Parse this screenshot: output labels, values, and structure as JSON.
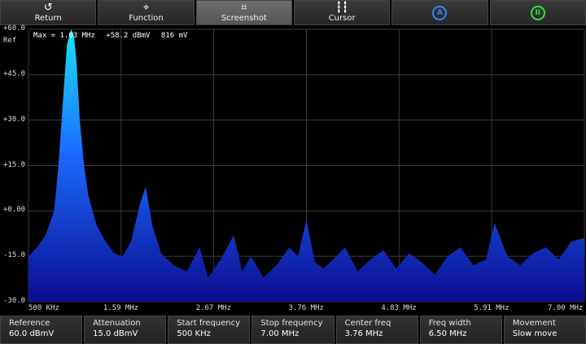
{
  "toolbar": {
    "return_label": "Return",
    "function_label": "Function",
    "screenshot_label": "Screenshot",
    "cursor_label": "Cursor",
    "auto_label": "A",
    "pause_label": "II"
  },
  "marker": {
    "max": "Max = 1.03 MHz",
    "level": "+58.2 dBmV",
    "voltage": "816 mV"
  },
  "axes": {
    "y_top_extra": "Ref",
    "y_ticks": [
      "+60.0",
      "+45.0",
      "+30.0",
      "+15.0",
      "+0.00",
      "-15.0",
      "-30.0"
    ],
    "x_ticks": [
      "500 KHz",
      "1.59 MHz",
      "2.67 MHz",
      "3.76 MHz",
      "4.83 MHz",
      "5.91 MHz",
      "7.00 MHz"
    ]
  },
  "colors": {
    "trace_top": "#19e4ff",
    "trace_bottom": "#1010a0",
    "grid": "#3c3c3c"
  },
  "params": [
    {
      "label": "Reference",
      "value": "60.0 dBmV"
    },
    {
      "label": "Attenuation",
      "value": "15.0 dBmV"
    },
    {
      "label": "Start frequency",
      "value": "500 KHz"
    },
    {
      "label": "Stop frequency",
      "value": "7.00 MHz"
    },
    {
      "label": "Center freq",
      "value": "3.76 MHz"
    },
    {
      "label": "Freq width",
      "value": "6.50 MHz"
    },
    {
      "label": "Movement",
      "value": "Slow move"
    }
  ],
  "chart_data": {
    "type": "area",
    "xlim": [
      0.5,
      7.0
    ],
    "ylim": [
      -30,
      60
    ],
    "x": [
      0.5,
      0.6,
      0.7,
      0.8,
      0.85,
      0.9,
      0.95,
      1.0,
      1.03,
      1.06,
      1.1,
      1.15,
      1.2,
      1.3,
      1.4,
      1.5,
      1.6,
      1.7,
      1.8,
      1.87,
      1.95,
      2.05,
      2.2,
      2.35,
      2.5,
      2.6,
      2.75,
      2.9,
      3.0,
      3.1,
      3.25,
      3.4,
      3.55,
      3.65,
      3.75,
      3.85,
      3.95,
      4.1,
      4.2,
      4.35,
      4.5,
      4.65,
      4.8,
      4.95,
      5.1,
      5.25,
      5.4,
      5.55,
      5.7,
      5.85,
      5.95,
      6.1,
      6.25,
      6.4,
      6.55,
      6.7,
      6.85,
      7.0
    ],
    "y": [
      -15,
      -12,
      -8,
      0,
      15,
      35,
      55,
      60,
      58.2,
      50,
      30,
      15,
      5,
      -5,
      -10,
      -14,
      -15,
      -10,
      2,
      8,
      -5,
      -14,
      -18,
      -20,
      -12,
      -22,
      -16,
      -8,
      -20,
      -15,
      -22,
      -18,
      -12,
      -15,
      -3,
      -17,
      -19,
      -15,
      -12,
      -20,
      -16,
      -13,
      -19,
      -14,
      -17,
      -21,
      -15,
      -12,
      -18,
      -16,
      -4,
      -15,
      -18,
      -14,
      -12,
      -16,
      -10,
      -9
    ]
  }
}
